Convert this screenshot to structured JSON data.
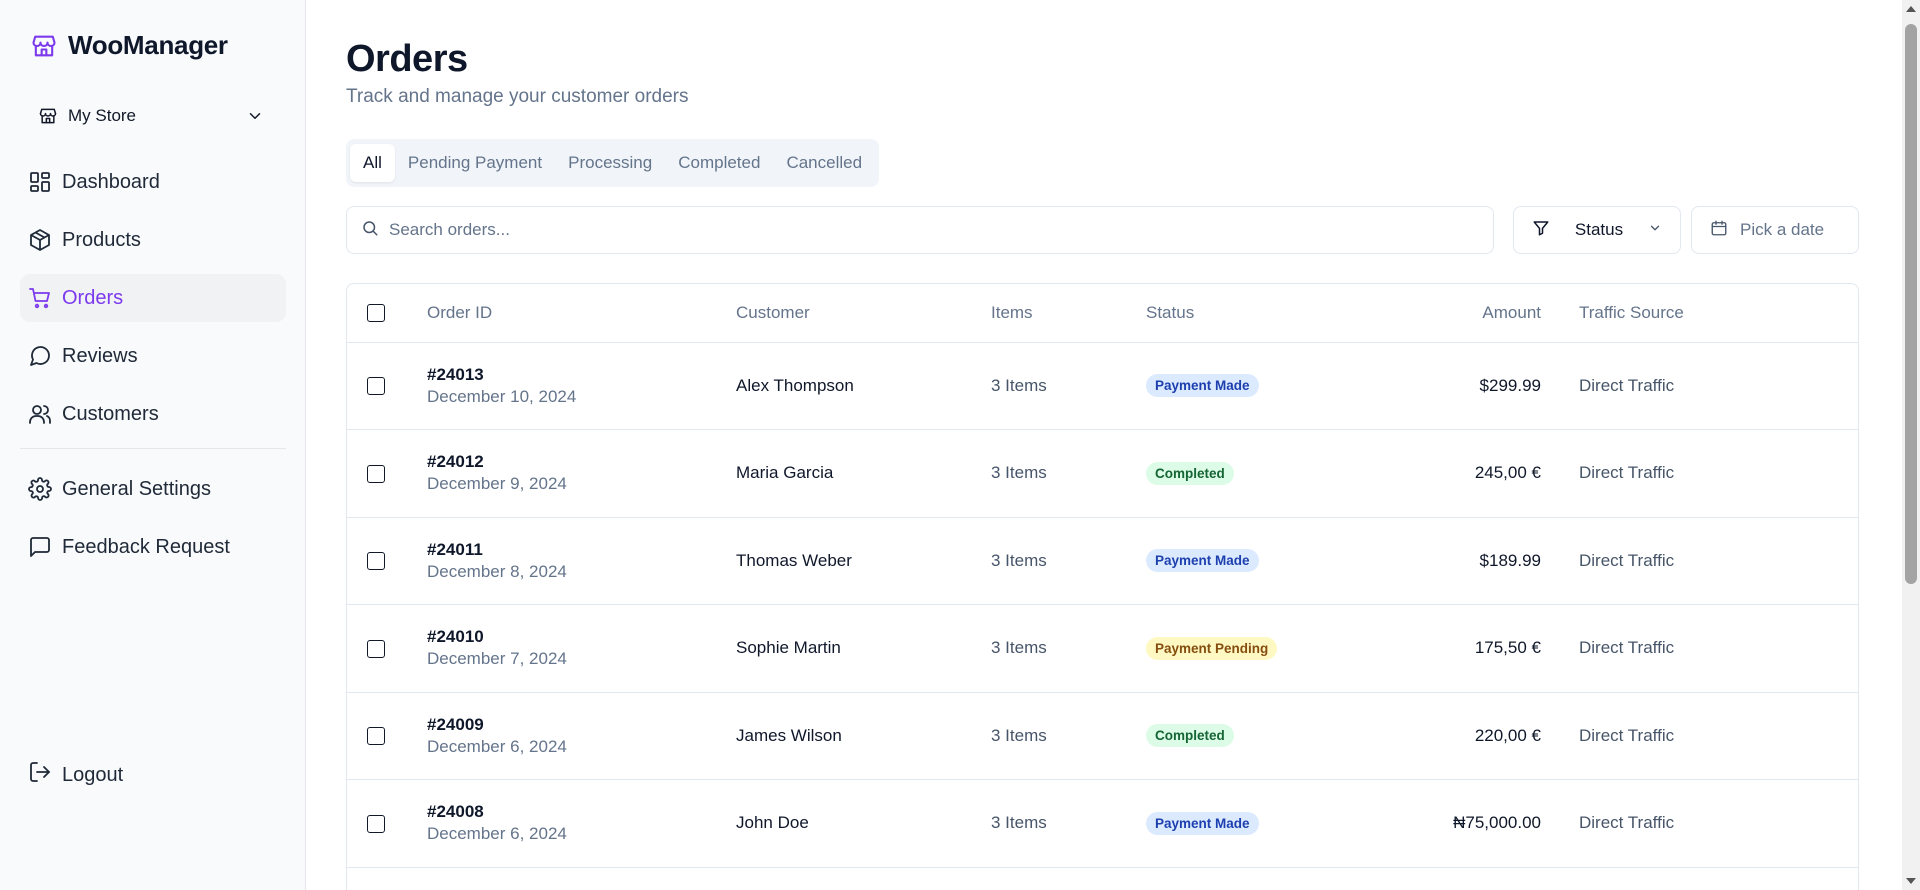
{
  "app": {
    "name": "WooManager"
  },
  "store": {
    "name": "My Store"
  },
  "nav": {
    "items": [
      {
        "label": "Dashboard",
        "icon": "dashboard-icon",
        "active": false
      },
      {
        "label": "Products",
        "icon": "package-icon",
        "active": false
      },
      {
        "label": "Orders",
        "icon": "cart-icon",
        "active": true
      },
      {
        "label": "Reviews",
        "icon": "message-circle-icon",
        "active": false
      },
      {
        "label": "Customers",
        "icon": "users-icon",
        "active": false
      }
    ],
    "secondary": [
      {
        "label": "General Settings",
        "icon": "gear-icon"
      },
      {
        "label": "Feedback Request",
        "icon": "message-square-icon"
      }
    ],
    "logout": "Logout"
  },
  "page": {
    "title": "Orders",
    "subtitle": "Track and manage your customer orders"
  },
  "tabs": [
    "All",
    "Pending Payment",
    "Processing",
    "Completed",
    "Cancelled"
  ],
  "active_tab": "All",
  "search": {
    "placeholder": "Search orders..."
  },
  "filters": {
    "status_label": "Status",
    "date_placeholder": "Pick a date"
  },
  "table": {
    "headers": {
      "order_id": "Order ID",
      "customer": "Customer",
      "items": "Items",
      "status": "Status",
      "amount": "Amount",
      "source": "Traffic Source"
    },
    "rows": [
      {
        "id": "#24013",
        "date": "December 10, 2024",
        "customer": "Alex Thompson",
        "items": "3 Items",
        "status": "Payment Made",
        "status_type": "made",
        "amount": "$299.99",
        "source": "Direct Traffic"
      },
      {
        "id": "#24012",
        "date": "December 9, 2024",
        "customer": "Maria Garcia",
        "items": "3 Items",
        "status": "Completed",
        "status_type": "completed",
        "amount": "245,00 €",
        "source": "Direct Traffic"
      },
      {
        "id": "#24011",
        "date": "December 8, 2024",
        "customer": "Thomas Weber",
        "items": "3 Items",
        "status": "Payment Made",
        "status_type": "made",
        "amount": "$189.99",
        "source": "Direct Traffic"
      },
      {
        "id": "#24010",
        "date": "December 7, 2024",
        "customer": "Sophie Martin",
        "items": "3 Items",
        "status": "Payment Pending",
        "status_type": "pending",
        "amount": "175,50 €",
        "source": "Direct Traffic"
      },
      {
        "id": "#24009",
        "date": "December 6, 2024",
        "customer": "James Wilson",
        "items": "3 Items",
        "status": "Completed",
        "status_type": "completed",
        "amount": "220,00 €",
        "source": "Direct Traffic"
      },
      {
        "id": "#24008",
        "date": "December 6, 2024",
        "customer": "John Doe",
        "items": "3 Items",
        "status": "Payment Made",
        "status_type": "made",
        "amount": "₦75,000.00",
        "source": "Direct Traffic"
      }
    ]
  },
  "colors": {
    "accent": "#7c3aed",
    "badge_made_bg": "#dbeafe",
    "badge_completed_bg": "#dcfce7",
    "badge_pending_bg": "#fef9c3"
  }
}
